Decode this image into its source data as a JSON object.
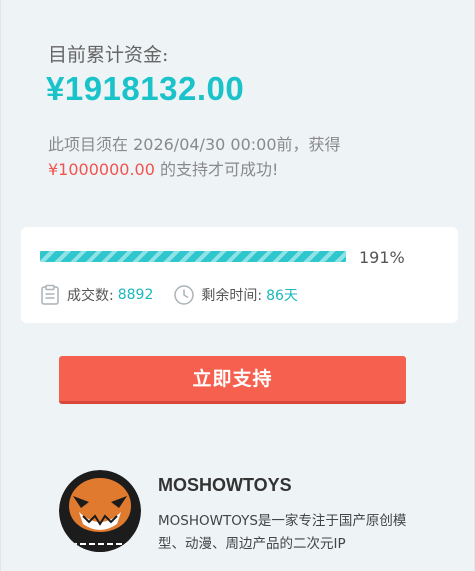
{
  "funding": {
    "raised_label": "目前累计资金:",
    "raised_amount": "¥1918132.00",
    "deadline_prefix": "此项目须在 2026/04/30 00:00前，获得",
    "goal_amount": "¥1000000.00",
    "deadline_suffix": " 的支持才可成功!"
  },
  "progress": {
    "fraction": 1.0,
    "percent_label": "191%",
    "deals_label": "成交数:",
    "deals_value": "8892",
    "remaining_label": "剩余时间:",
    "remaining_value": "86天"
  },
  "support_button": "立即支持",
  "creator": {
    "name": "MOSHOWTOYS",
    "description": "MOSHOWTOYS是一家专注于国产原创模型、动漫、周边产品的二次元IP"
  },
  "icons": {
    "deals": "clipboard-icon",
    "remaining": "clock-icon"
  },
  "colors": {
    "accent": "#19c3c9",
    "goal": "#f0544f",
    "button": "#f5604f",
    "background": "#eef3f6"
  }
}
